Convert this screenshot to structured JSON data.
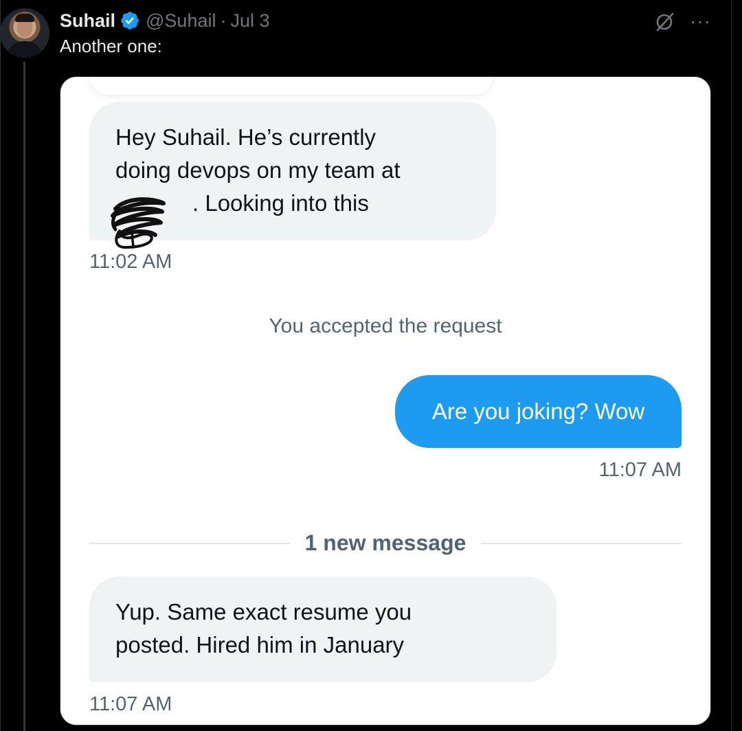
{
  "tweet": {
    "author": {
      "name": "Suhail",
      "handle": "@Suhail",
      "verified": true
    },
    "separator": "·",
    "date": "Jul 3",
    "text": "Another one:",
    "actions": {
      "grok_icon": "grok-icon",
      "more_label": "···"
    }
  },
  "screenshot": {
    "messages": [
      {
        "direction": "incoming",
        "lines": [
          "Hey Suhail. He’s currently",
          "doing devops on my team at",
          ". Looking into this"
        ],
        "time": "11:02 AM"
      },
      {
        "direction": "outgoing",
        "text": "Are you joking? Wow",
        "time": "11:07 AM"
      },
      {
        "direction": "incoming",
        "lines": [
          "Yup. Same exact resume you",
          "posted. Hired him in January"
        ],
        "time": "11:07 AM"
      }
    ],
    "system_note": "You accepted the request",
    "new_message_divider": "1 new message"
  },
  "colors": {
    "background": "#000000",
    "accent": "#1d9bf0",
    "incoming_bubble": "#eff3f4",
    "muted_text": "#71767b"
  }
}
